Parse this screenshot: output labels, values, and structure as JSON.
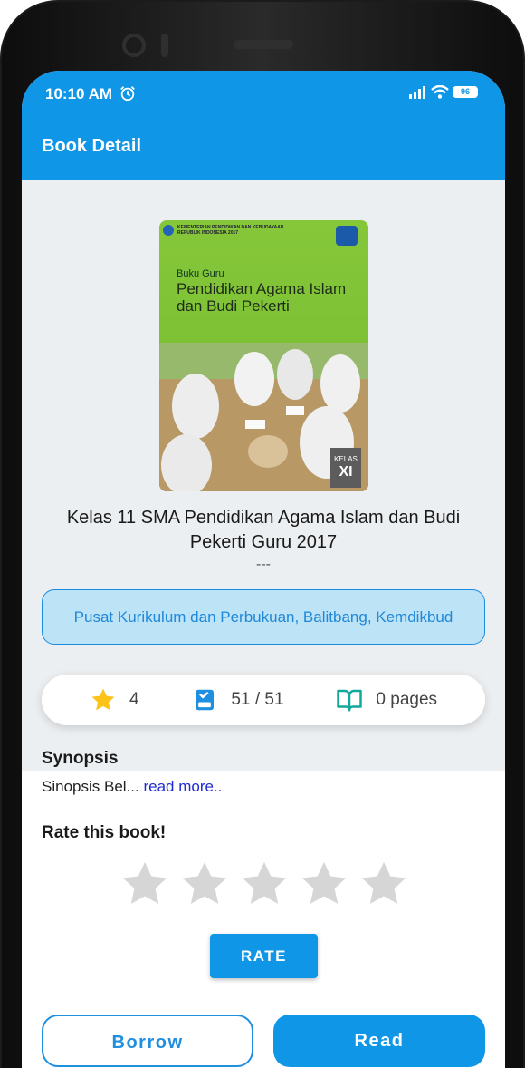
{
  "status_bar": {
    "time": "10:10 AM",
    "battery": "96"
  },
  "app_bar": {
    "title": "Book Detail"
  },
  "cover": {
    "ministry": "KEMENTERIAN PENDIDIKAN DAN KEBUDAYAAN REPUBLIK INDONESIA 2017",
    "subtitle": "Buku Guru",
    "title": "Pendidikan Agama Islam dan Budi Pekerti",
    "level_label": "KELAS",
    "level": "XI"
  },
  "book": {
    "title": "Kelas 11 SMA Pendidikan Agama Islam dan Budi Pekerti Guru 2017",
    "author": "---",
    "publisher": "Pusat Kurikulum dan Perbukuan, Balitbang, Kemdikbud"
  },
  "stats": {
    "rating": "4",
    "stock": "51 / 51",
    "pages": "0 pages"
  },
  "synopsis": {
    "title": "Synopsis",
    "text": "Sinopsis Bel...",
    "read_more": "read more.."
  },
  "rating": {
    "title": "Rate this book!",
    "stars_total": 5,
    "selected": 0,
    "button": "RATE"
  },
  "actions": {
    "borrow": "Borrow",
    "read": "Read"
  },
  "colors": {
    "primary": "#0f96e6",
    "hero_bg": "#eceff1",
    "star_active": "#fcc419",
    "star_inactive": "#d6d6d6"
  }
}
